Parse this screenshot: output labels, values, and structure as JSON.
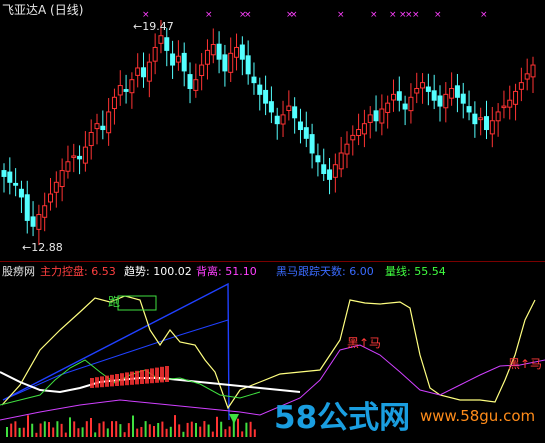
{
  "header": {
    "stock_title": "飞亚达A (日线)"
  },
  "price_panel": {
    "high_label": "19.47",
    "low_label": "12.88",
    "arrow_glyph": "←"
  },
  "indicator_bar": {
    "name": "股痨网",
    "items": [
      {
        "label": "主力控盘:",
        "value": "6.53",
        "color": "#ff4040"
      },
      {
        "label": "趋势:",
        "value": "100.02",
        "color": "#ffffff"
      },
      {
        "label": "背离:",
        "value": "51.10",
        "color": "#ff40ff"
      },
      {
        "label": "黑马跟踪天数:",
        "value": "6.00",
        "color": "#3a6bff"
      },
      {
        "label": "量线:",
        "value": "55.54",
        "color": "#40ff40"
      }
    ]
  },
  "chart_labels": {
    "pao": "跑",
    "heima_1": "黑↑马",
    "heima_2": "黑↑马"
  },
  "watermark": {
    "big": "58公式网",
    "small": "www.58gu.com"
  },
  "colors": {
    "up_candle": "#ff3333",
    "down_candle": "#54ffff",
    "marker": "#ff40ff",
    "line_yellow": "#ffff80",
    "line_white": "#ffffff",
    "line_green": "#40e040",
    "line_purple": "#d040ff",
    "line_blue": "#2040ff"
  },
  "chart_data": {
    "type": "candlestick",
    "price_range": [
      12.88,
      19.47
    ],
    "candles_note": "approximate daily closes read from chart",
    "closes": [
      14.6,
      14.4,
      14.3,
      13.9,
      13.1,
      12.9,
      13.3,
      13.6,
      14.0,
      14.4,
      14.8,
      15.1,
      15.3,
      15.2,
      15.6,
      16.1,
      16.4,
      16.2,
      16.8,
      17.3,
      17.7,
      17.5,
      17.9,
      18.3,
      18.0,
      18.5,
      19.0,
      19.4,
      18.9,
      18.4,
      18.7,
      18.2,
      17.6,
      17.9,
      18.4,
      18.9,
      19.1,
      18.6,
      18.2,
      18.8,
      19.0,
      18.6,
      18.1,
      17.8,
      17.4,
      17.1,
      16.8,
      16.4,
      16.7,
      17.0,
      16.6,
      16.2,
      15.9,
      15.4,
      15.1,
      14.7,
      14.5,
      15.0,
      15.4,
      15.7,
      16.0,
      16.2,
      16.4,
      16.7,
      16.5,
      16.9,
      17.1,
      17.4,
      17.2,
      16.9,
      17.3,
      17.6,
      17.8,
      17.5,
      17.2,
      17.0,
      17.4,
      17.6,
      17.3,
      17.1,
      16.8,
      16.4,
      16.6,
      16.2,
      16.5,
      16.8,
      17.0,
      17.2,
      17.5,
      17.8,
      18.1,
      18.4
    ]
  }
}
